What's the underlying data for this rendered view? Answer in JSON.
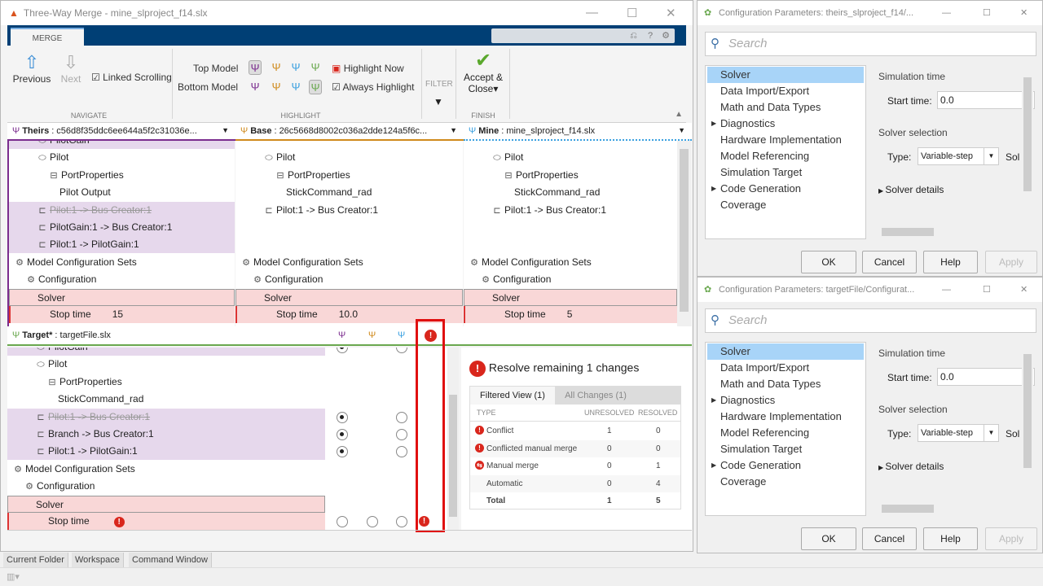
{
  "main_window": {
    "title": "Three-Way Merge - mine_slproject_f14.slx",
    "tab": "MERGE",
    "navigate": {
      "previous": "Previous",
      "next": "Next",
      "linked_scrolling": "Linked Scrolling",
      "linked_scrolling_checked": true,
      "group": "NAVIGATE"
    },
    "highlight": {
      "top_model": "Top Model",
      "bottom_model": "Bottom Model",
      "highlight_now": "Highlight Now",
      "always_highlight": "Always Highlight",
      "always_highlight_checked": true,
      "group": "HIGHLIGHT"
    },
    "filter": {
      "label": "FILTER"
    },
    "finish": {
      "accept_close": "Accept &",
      "accept_close2": "Close",
      "group": "FINISH"
    },
    "columns": [
      {
        "name": "Theirs",
        "value": "c56d8f35ddc6ee644a5f2c31036e...",
        "color": "#7b2d8e"
      },
      {
        "name": "Base",
        "value": "26c5668d8002c036a2dde124a5f6c...",
        "color": "#d08a1c"
      },
      {
        "name": "Mine",
        "value": "mine_slproject_f14.slx",
        "color": "#3aa0e0"
      }
    ],
    "theirs_rows": [
      {
        "text": "PilotGain",
        "icon": "block",
        "indent": 2,
        "style": "purple"
      },
      {
        "text": "Pilot",
        "icon": "block",
        "indent": 2
      },
      {
        "text": "PortProperties",
        "icon": "node",
        "indent": 3
      },
      {
        "text": "Pilot Output",
        "icon": "",
        "indent": 4
      },
      {
        "text": "Pilot:1 -> Bus Creator:1",
        "icon": "line",
        "indent": 2,
        "style": "purple strike"
      },
      {
        "text": "PilotGain:1 -> Bus Creator:1",
        "icon": "line",
        "indent": 2,
        "style": "purple"
      },
      {
        "text": "Pilot:1 -> PilotGain:1",
        "icon": "line",
        "indent": 2,
        "style": "purple"
      },
      {
        "text": "Model Configuration Sets",
        "icon": "gear",
        "indent": 0
      },
      {
        "text": "Configuration",
        "icon": "gear",
        "indent": 1
      },
      {
        "text": "Solver",
        "icon": "",
        "indent": 2,
        "style": "pink"
      },
      {
        "text": "Stop time",
        "value": "15",
        "icon": "",
        "indent": 3,
        "style": "pink"
      }
    ],
    "base_rows": [
      {
        "text": "",
        "icon": "",
        "indent": 2
      },
      {
        "text": "Pilot",
        "icon": "block",
        "indent": 2
      },
      {
        "text": "PortProperties",
        "icon": "node",
        "indent": 3
      },
      {
        "text": "StickCommand_rad",
        "icon": "",
        "indent": 4
      },
      {
        "text": "Pilot:1 -> Bus Creator:1",
        "icon": "line",
        "indent": 2
      },
      {
        "text": "",
        "icon": "",
        "indent": 2
      },
      {
        "text": "",
        "icon": "",
        "indent": 2
      },
      {
        "text": "Model Configuration Sets",
        "icon": "gear",
        "indent": 0
      },
      {
        "text": "Configuration",
        "icon": "gear",
        "indent": 1
      },
      {
        "text": "Solver",
        "icon": "",
        "indent": 2,
        "style": "pink"
      },
      {
        "text": "Stop time",
        "value": "10.0",
        "icon": "",
        "indent": 3,
        "style": "pink"
      }
    ],
    "mine_rows": [
      {
        "text": "",
        "icon": "",
        "indent": 2
      },
      {
        "text": "Pilot",
        "icon": "block",
        "indent": 2
      },
      {
        "text": "PortProperties",
        "icon": "node",
        "indent": 3
      },
      {
        "text": "StickCommand_rad",
        "icon": "",
        "indent": 4
      },
      {
        "text": "Pilot:1 -> Bus Creator:1",
        "icon": "line",
        "indent": 2
      },
      {
        "text": "",
        "icon": "",
        "indent": 2
      },
      {
        "text": "",
        "icon": "",
        "indent": 2
      },
      {
        "text": "Model Configuration Sets",
        "icon": "gear",
        "indent": 0
      },
      {
        "text": "Configuration",
        "icon": "gear",
        "indent": 1
      },
      {
        "text": "Solver",
        "icon": "",
        "indent": 2,
        "style": "pink"
      },
      {
        "text": "Stop time",
        "value": "5",
        "icon": "",
        "indent": 3,
        "style": "pink"
      }
    ],
    "target": {
      "name": "Target*",
      "file": "targetFile.slx",
      "rows": [
        {
          "text": "PilotGain",
          "icon": "block",
          "indent": 2,
          "style": "purple",
          "radios": [
            true,
            null,
            false
          ]
        },
        {
          "text": "Pilot",
          "icon": "block",
          "indent": 2
        },
        {
          "text": "PortProperties",
          "icon": "node",
          "indent": 3
        },
        {
          "text": "StickCommand_rad",
          "icon": "",
          "indent": 4
        },
        {
          "text": "Pilot:1 -> Bus Creator:1",
          "icon": "line",
          "indent": 2,
          "style": "purple strike",
          "radios": [
            true,
            null,
            false
          ]
        },
        {
          "text": "Branch -> Bus Creator:1",
          "icon": "line",
          "indent": 2,
          "style": "purple",
          "radios": [
            true,
            null,
            false
          ]
        },
        {
          "text": "Pilot:1 -> PilotGain:1",
          "icon": "line",
          "indent": 2,
          "style": "purple",
          "radios": [
            true,
            null,
            false
          ]
        },
        {
          "text": "Model Configuration Sets",
          "icon": "gear",
          "indent": 0
        },
        {
          "text": "Configuration",
          "icon": "gear",
          "indent": 1
        },
        {
          "text": "Solver",
          "icon": "",
          "indent": 2,
          "style": "pink"
        },
        {
          "text": "Stop time",
          "icon": "",
          "indent": 3,
          "style": "pink",
          "conflict": true,
          "radios": [
            false,
            false,
            false
          ]
        }
      ]
    },
    "summary": {
      "title": "Resolve remaining 1 changes",
      "tabs": [
        "Filtered View (1)",
        "All Changes (1)"
      ],
      "headers": [
        "TYPE",
        "UNRESOLVED",
        "RESOLVED"
      ],
      "rows": [
        {
          "type": "Conflict",
          "icon": "conflict-icon",
          "unresolved": "1",
          "resolved": "0"
        },
        {
          "type": "Conflicted manual merge",
          "icon": "conflicted-manual-merge-icon",
          "unresolved": "0",
          "resolved": "0"
        },
        {
          "type": "Manual merge",
          "icon": "manual-merge-icon",
          "unresolved": "0",
          "resolved": "1"
        },
        {
          "type": "Automatic",
          "icon": "",
          "unresolved": "0",
          "resolved": "4"
        },
        {
          "type": "Total",
          "icon": "",
          "unresolved": "1",
          "resolved": "5"
        }
      ]
    },
    "bottom_tabs": [
      "Current Folder",
      "Workspace",
      "Command Window"
    ]
  },
  "dialogs": [
    {
      "title": "Configuration Parameters: theirs_slproject_f14/...",
      "search_placeholder": "Search",
      "nav": [
        "Solver",
        "Data Import/Export",
        "Math and Data Types",
        "Diagnostics",
        "Hardware Implementation",
        "Model Referencing",
        "Simulation Target",
        "Code Generation",
        "Coverage"
      ],
      "simulation_time": "Simulation time",
      "start_time_label": "Start time:",
      "start_time": "0.0",
      "solver_selection": "Solver selection",
      "type_label": "Type:",
      "type": "Variable-step",
      "solver_cut": "Sol",
      "solver_details": "Solver details",
      "ok": "OK",
      "cancel": "Cancel",
      "help": "Help",
      "apply": "Apply"
    },
    {
      "title": "Configuration Parameters: targetFile/Configurat...",
      "search_placeholder": "Search",
      "nav": [
        "Solver",
        "Data Import/Export",
        "Math and Data Types",
        "Diagnostics",
        "Hardware Implementation",
        "Model Referencing",
        "Simulation Target",
        "Code Generation",
        "Coverage"
      ],
      "simulation_time": "Simulation time",
      "start_time_label": "Start time:",
      "start_time": "0.0",
      "solver_selection": "Solver selection",
      "type_label": "Type:",
      "type": "Variable-step",
      "solver_cut": "Sol",
      "solver_details": "Solver details",
      "ok": "OK",
      "cancel": "Cancel",
      "help": "Help",
      "apply": "Apply"
    }
  ],
  "colors": {
    "ribbon": "#003f75",
    "conflict": "#d9261c",
    "target": "#6aa84f",
    "purple_row": "#e6d8ec",
    "pink_row": "#f9d7d7"
  }
}
